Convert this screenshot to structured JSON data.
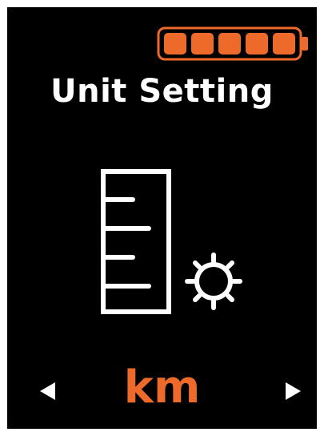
{
  "header": {
    "battery_level": 1.0,
    "battery_segments": 5,
    "battery_icon": "battery-icon"
  },
  "page": {
    "title": "Unit Setting",
    "illustration_icon": "ruler-gear-icon"
  },
  "selector": {
    "value": "km",
    "prev_icon": "triangle-left-icon",
    "next_icon": "triangle-right-icon"
  },
  "colors": {
    "background": "#000000",
    "text": "#ffffff",
    "accent": "#ee6a2a"
  }
}
